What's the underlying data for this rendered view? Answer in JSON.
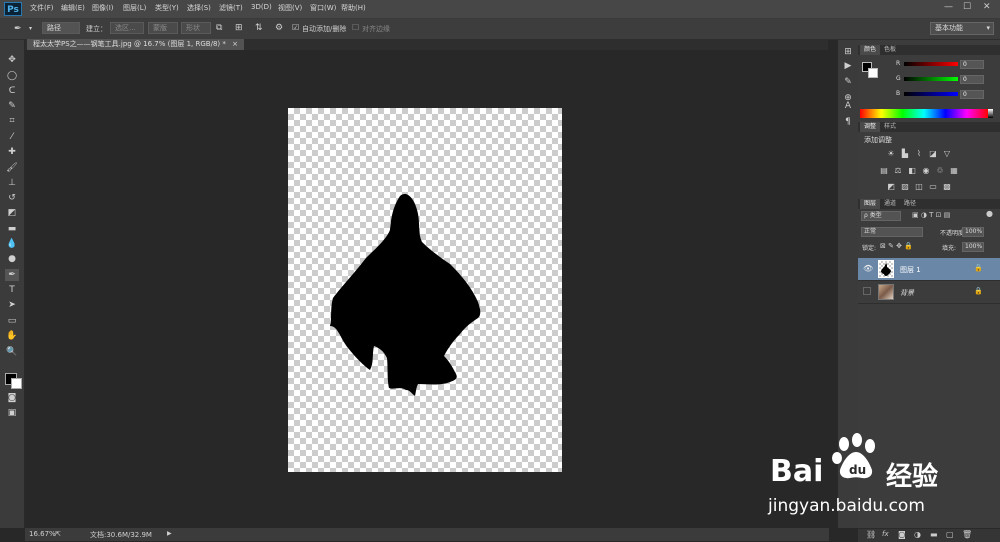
{
  "app": {
    "logo": "Ps"
  },
  "menu": [
    "文件(F)",
    "编辑(E)",
    "图像(I)",
    "图层(L)",
    "类型(Y)",
    "选择(S)",
    "滤镜(T)",
    "3D(D)",
    "视图(V)",
    "窗口(W)",
    "帮助(H)"
  ],
  "window_controls": {
    "minimize": "—",
    "maximize": "☐",
    "close": "✕"
  },
  "options": {
    "tool_icon": "pen-tool-icon",
    "mode": "路径",
    "build_label": "建立：",
    "selection_btn": "选区...",
    "mask_btn": "蒙版",
    "shape_btn": "形状",
    "auto_add_delete": "自动添加/删除",
    "auto_add_checked": true,
    "align_edges": "对齐边缘",
    "workspace": "基本功能"
  },
  "document": {
    "tab_title": "程太太学PS之——钢笔工具.jpg @ 16.7% (图层 1, RGB/8) *",
    "close": "×"
  },
  "status": {
    "zoom": "16.67%",
    "doc_size": "文档:30.6M/32.9M"
  },
  "color_panel": {
    "tabs": [
      "颜色",
      "色板"
    ],
    "r_label": "R",
    "r_value": "0",
    "g_label": "G",
    "g_value": "0",
    "b_label": "B",
    "b_value": "0"
  },
  "adjust_panel": {
    "tabs": [
      "调整",
      "样式"
    ],
    "heading": "添加调整"
  },
  "layers_panel": {
    "tabs": [
      "图层",
      "通道",
      "路径"
    ],
    "filter_kind": "ρ 类型",
    "blend_mode": "正常",
    "opacity_label": "不透明度:",
    "opacity_value": "100%",
    "lock_label": "锁定:",
    "fill_label": "填充:",
    "fill_value": "100%",
    "layers": [
      {
        "name": "图层 1",
        "selected": true,
        "visible": true
      },
      {
        "name": "背景",
        "selected": false,
        "visible": false
      }
    ]
  },
  "watermark": {
    "brand": "Bai",
    "brand2": "du",
    "cn": "经验",
    "url": "jingyan.baidu.com"
  },
  "colors": {
    "accent_selected_layer": "#6a87a8",
    "foreground": "#000000",
    "background": "#ffffff"
  }
}
